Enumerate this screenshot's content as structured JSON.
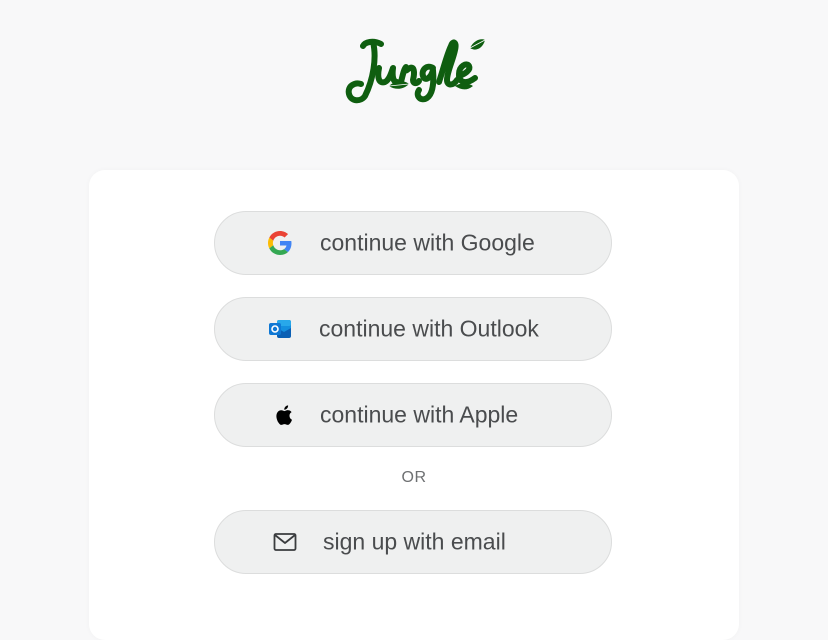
{
  "logo": {
    "text": "Jungle",
    "color": "#0f5e10"
  },
  "auth": {
    "google_label": "continue with Google",
    "outlook_label": "continue with Outlook",
    "apple_label": "continue with Apple",
    "separator": "OR",
    "email_label": "sign up with email"
  },
  "icons": {
    "google": "google-icon",
    "outlook": "outlook-icon",
    "apple": "apple-icon",
    "email": "envelope-icon"
  },
  "colors": {
    "page_bg": "#f8f8f9",
    "card_bg": "#ffffff",
    "button_bg": "#eff0f0",
    "button_text": "#4a4c4e",
    "brand_green": "#0f5e10"
  }
}
